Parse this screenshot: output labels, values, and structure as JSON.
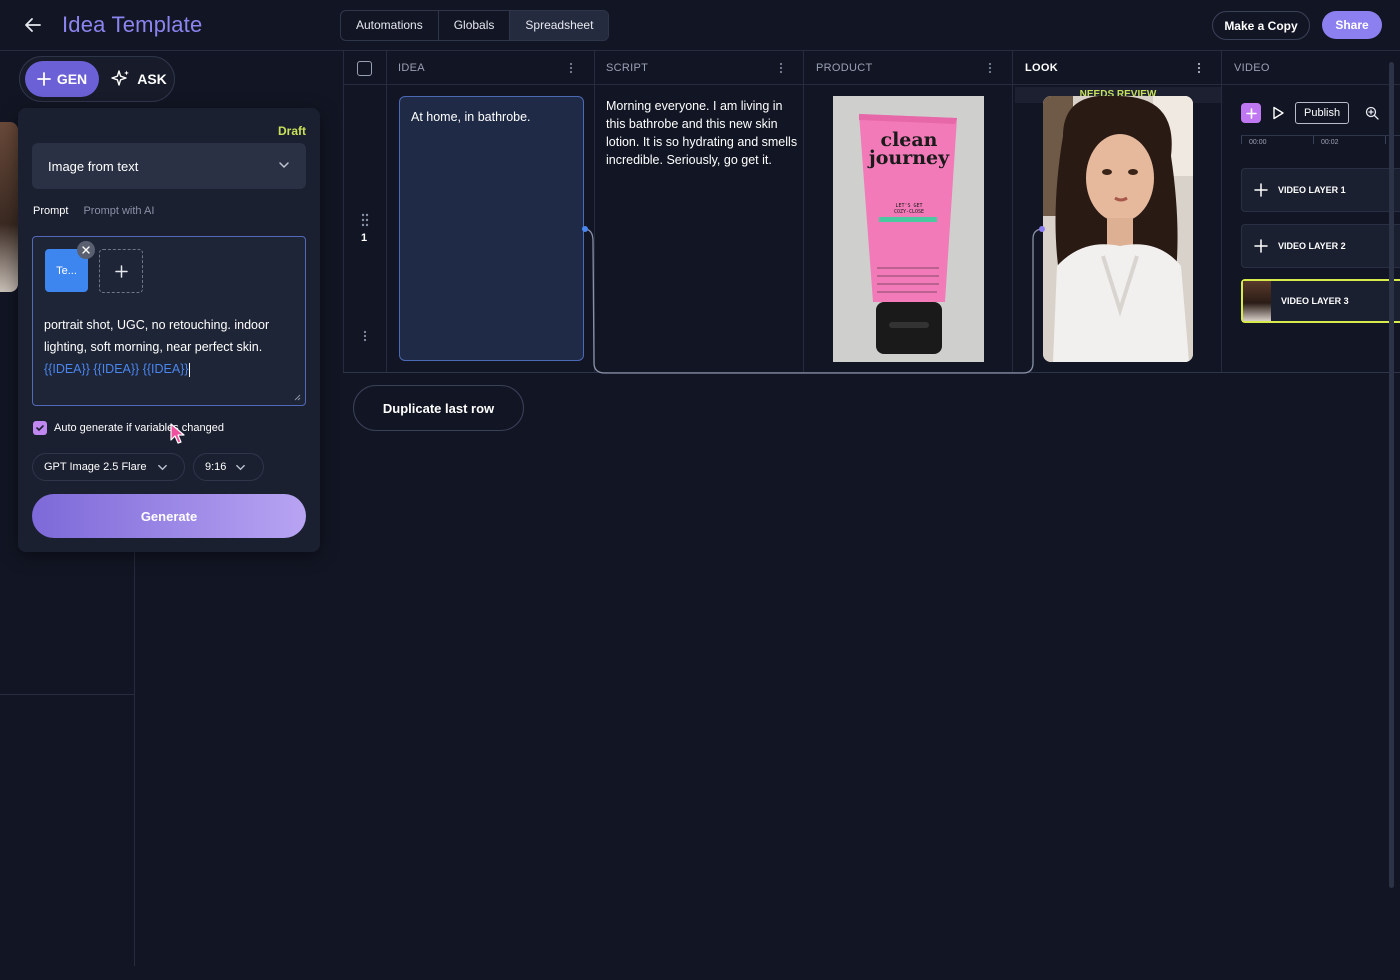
{
  "header": {
    "title": "Idea Template",
    "tabs": [
      {
        "label": "Automations"
      },
      {
        "label": "Globals"
      },
      {
        "label": "Spreadsheet"
      }
    ],
    "make_copy_label": "Make a Copy",
    "share_label": "Share"
  },
  "mode": {
    "gen_label": "GEN",
    "ask_label": "ASK"
  },
  "panel": {
    "status": "Draft",
    "type_value": "Image from text",
    "prompt_tab": "Prompt",
    "prompt_ai_tab": "Prompt with AI",
    "chip_label": "Te...",
    "prompt_text": "portrait shot, UGC, no retouching. indoor lighting, soft morning, near perfect skin.",
    "prompt_vars": "{{IDEA}} {{IDEA}} {{IDEA}}",
    "auto_generate_label": "Auto generate if variables changed",
    "auto_generate_checked": true,
    "model_value": "GPT Image 2.5 Flare",
    "ratio_value": "9:16",
    "generate_label": "Generate"
  },
  "sheet": {
    "columns": [
      {
        "label": "IDEA"
      },
      {
        "label": "SCRIPT"
      },
      {
        "label": "PRODUCT"
      },
      {
        "label": "LOOK"
      },
      {
        "label": "VIDEO"
      }
    ],
    "rows": [
      {
        "number": "1",
        "idea": "At home, in bathrobe.",
        "script": "Morning everyone. I am living in this bathrobe and this new skin lotion. It is so hydrating and smells incredible. Seriously, go get it.",
        "look_status": "NEEDS REVIEW"
      }
    ],
    "duplicate_label": "Duplicate last row"
  },
  "product_image": {
    "brand_line1": "clean",
    "brand_line2": "journey",
    "tagline1": "LET'S GET",
    "tagline2": "COZY-CLOSE",
    "color": "#f27ab8"
  },
  "video": {
    "publish_label": "Publish",
    "time_marks": [
      "00:00",
      "00:02"
    ],
    "layers": [
      {
        "label": "VIDEO LAYER 1"
      },
      {
        "label": "VIDEO LAYER 2"
      },
      {
        "label": "VIDEO LAYER 3"
      }
    ]
  },
  "colors": {
    "accent": "#8c7ff0",
    "draft": "#c8e05a",
    "selected_layer": "#d7ec4a",
    "variable": "#4a86f0"
  }
}
